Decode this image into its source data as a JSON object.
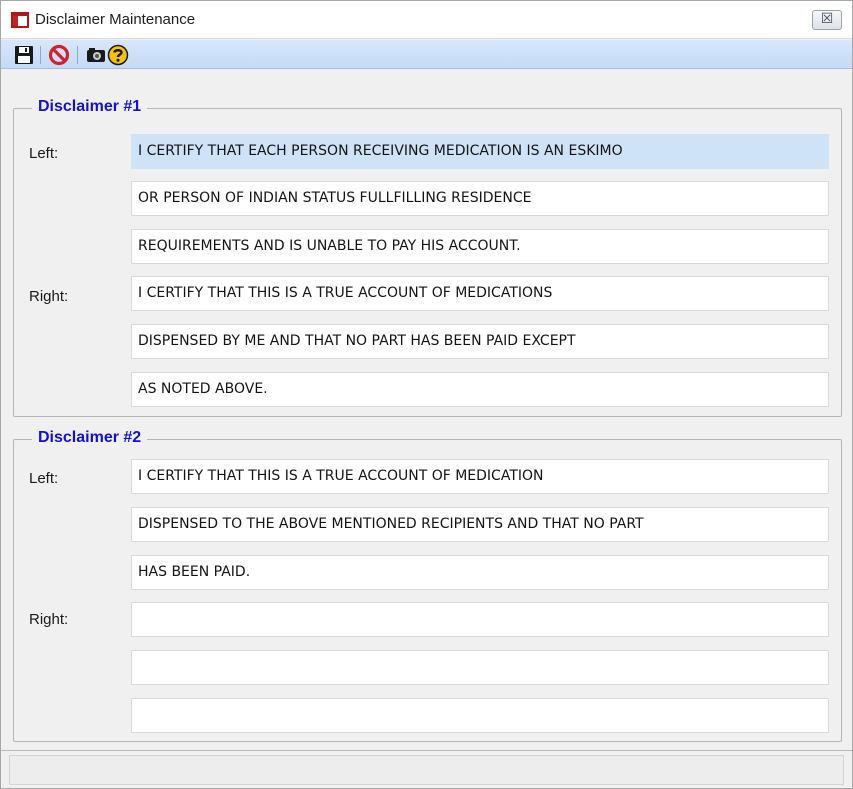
{
  "window": {
    "title": "Disclaimer Maintenance",
    "close_glyph": "☒"
  },
  "toolbar": {
    "buttons": [
      {
        "name": "save-icon",
        "tooltip": ""
      },
      {
        "name": "cancel-icon",
        "tooltip": ""
      },
      {
        "name": "preview-icon",
        "tooltip": ""
      },
      {
        "name": "help-icon",
        "tooltip": ""
      }
    ]
  },
  "disclaimer1": {
    "title": "Disclaimer #1",
    "left_label": "Left:",
    "right_label": "Right:",
    "left": [
      "I CERTIFY THAT EACH PERSON RECEIVING MEDICATION IS AN ESKIMO",
      "OR PERSON OF INDIAN STATUS FULLFILLING RESIDENCE",
      "REQUIREMENTS AND IS UNABLE TO PAY HIS ACCOUNT."
    ],
    "right": [
      "I CERTIFY THAT THIS IS A TRUE ACCOUNT OF MEDICATIONS",
      "DISPENSED BY ME AND THAT NO PART HAS BEEN PAID EXCEPT",
      "AS NOTED ABOVE."
    ]
  },
  "disclaimer2": {
    "title": "Disclaimer #2",
    "left_label": "Left:",
    "right_label": "Right:",
    "left": [
      "I CERTIFY THAT THIS IS A TRUE ACCOUNT OF MEDICATION",
      "DISPENSED TO THE ABOVE MENTIONED RECIPIENTS AND THAT NO PART",
      "HAS BEEN PAID."
    ],
    "right": [
      "",
      "",
      ""
    ]
  },
  "status": {
    "text": ""
  }
}
